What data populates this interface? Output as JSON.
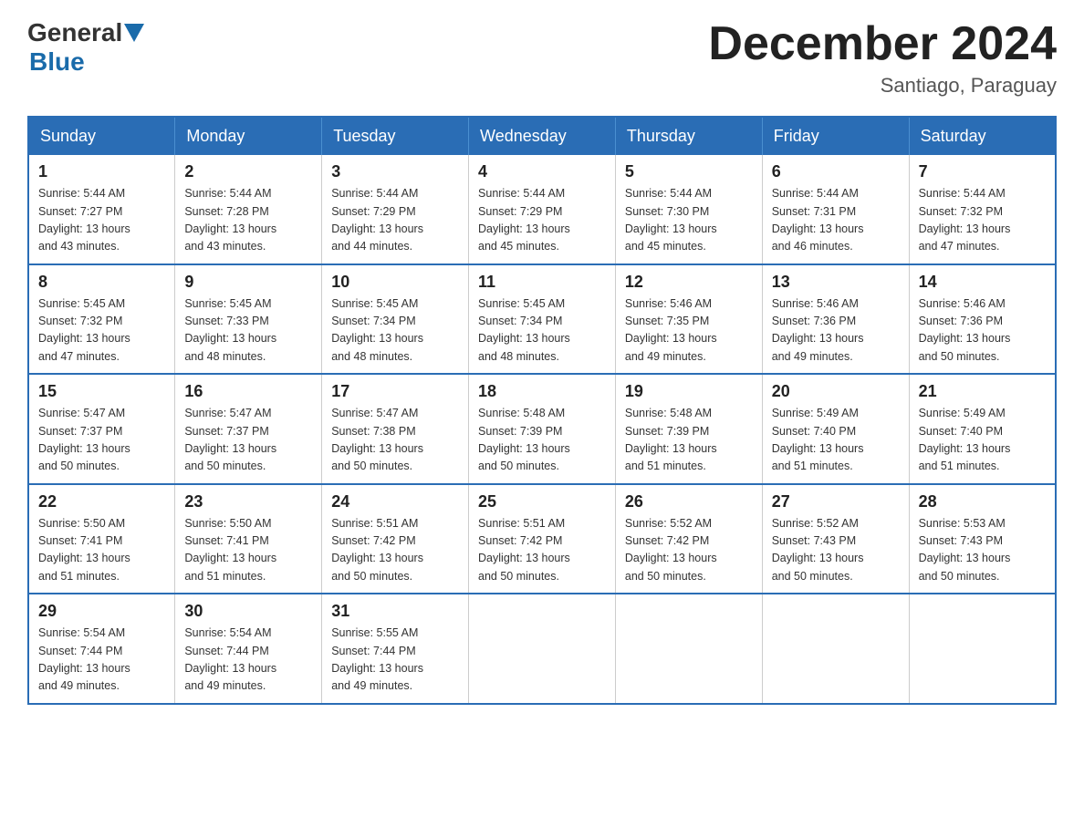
{
  "header": {
    "logo_general": "General",
    "logo_blue": "Blue",
    "month_title": "December 2024",
    "location": "Santiago, Paraguay"
  },
  "days_of_week": [
    "Sunday",
    "Monday",
    "Tuesday",
    "Wednesday",
    "Thursday",
    "Friday",
    "Saturday"
  ],
  "weeks": [
    [
      {
        "day": "1",
        "sunrise": "5:44 AM",
        "sunset": "7:27 PM",
        "daylight": "13 hours and 43 minutes."
      },
      {
        "day": "2",
        "sunrise": "5:44 AM",
        "sunset": "7:28 PM",
        "daylight": "13 hours and 43 minutes."
      },
      {
        "day": "3",
        "sunrise": "5:44 AM",
        "sunset": "7:29 PM",
        "daylight": "13 hours and 44 minutes."
      },
      {
        "day": "4",
        "sunrise": "5:44 AM",
        "sunset": "7:29 PM",
        "daylight": "13 hours and 45 minutes."
      },
      {
        "day": "5",
        "sunrise": "5:44 AM",
        "sunset": "7:30 PM",
        "daylight": "13 hours and 45 minutes."
      },
      {
        "day": "6",
        "sunrise": "5:44 AM",
        "sunset": "7:31 PM",
        "daylight": "13 hours and 46 minutes."
      },
      {
        "day": "7",
        "sunrise": "5:44 AM",
        "sunset": "7:32 PM",
        "daylight": "13 hours and 47 minutes."
      }
    ],
    [
      {
        "day": "8",
        "sunrise": "5:45 AM",
        "sunset": "7:32 PM",
        "daylight": "13 hours and 47 minutes."
      },
      {
        "day": "9",
        "sunrise": "5:45 AM",
        "sunset": "7:33 PM",
        "daylight": "13 hours and 48 minutes."
      },
      {
        "day": "10",
        "sunrise": "5:45 AM",
        "sunset": "7:34 PM",
        "daylight": "13 hours and 48 minutes."
      },
      {
        "day": "11",
        "sunrise": "5:45 AM",
        "sunset": "7:34 PM",
        "daylight": "13 hours and 48 minutes."
      },
      {
        "day": "12",
        "sunrise": "5:46 AM",
        "sunset": "7:35 PM",
        "daylight": "13 hours and 49 minutes."
      },
      {
        "day": "13",
        "sunrise": "5:46 AM",
        "sunset": "7:36 PM",
        "daylight": "13 hours and 49 minutes."
      },
      {
        "day": "14",
        "sunrise": "5:46 AM",
        "sunset": "7:36 PM",
        "daylight": "13 hours and 50 minutes."
      }
    ],
    [
      {
        "day": "15",
        "sunrise": "5:47 AM",
        "sunset": "7:37 PM",
        "daylight": "13 hours and 50 minutes."
      },
      {
        "day": "16",
        "sunrise": "5:47 AM",
        "sunset": "7:37 PM",
        "daylight": "13 hours and 50 minutes."
      },
      {
        "day": "17",
        "sunrise": "5:47 AM",
        "sunset": "7:38 PM",
        "daylight": "13 hours and 50 minutes."
      },
      {
        "day": "18",
        "sunrise": "5:48 AM",
        "sunset": "7:39 PM",
        "daylight": "13 hours and 50 minutes."
      },
      {
        "day": "19",
        "sunrise": "5:48 AM",
        "sunset": "7:39 PM",
        "daylight": "13 hours and 51 minutes."
      },
      {
        "day": "20",
        "sunrise": "5:49 AM",
        "sunset": "7:40 PM",
        "daylight": "13 hours and 51 minutes."
      },
      {
        "day": "21",
        "sunrise": "5:49 AM",
        "sunset": "7:40 PM",
        "daylight": "13 hours and 51 minutes."
      }
    ],
    [
      {
        "day": "22",
        "sunrise": "5:50 AM",
        "sunset": "7:41 PM",
        "daylight": "13 hours and 51 minutes."
      },
      {
        "day": "23",
        "sunrise": "5:50 AM",
        "sunset": "7:41 PM",
        "daylight": "13 hours and 51 minutes."
      },
      {
        "day": "24",
        "sunrise": "5:51 AM",
        "sunset": "7:42 PM",
        "daylight": "13 hours and 50 minutes."
      },
      {
        "day": "25",
        "sunrise": "5:51 AM",
        "sunset": "7:42 PM",
        "daylight": "13 hours and 50 minutes."
      },
      {
        "day": "26",
        "sunrise": "5:52 AM",
        "sunset": "7:42 PM",
        "daylight": "13 hours and 50 minutes."
      },
      {
        "day": "27",
        "sunrise": "5:52 AM",
        "sunset": "7:43 PM",
        "daylight": "13 hours and 50 minutes."
      },
      {
        "day": "28",
        "sunrise": "5:53 AM",
        "sunset": "7:43 PM",
        "daylight": "13 hours and 50 minutes."
      }
    ],
    [
      {
        "day": "29",
        "sunrise": "5:54 AM",
        "sunset": "7:44 PM",
        "daylight": "13 hours and 49 minutes."
      },
      {
        "day": "30",
        "sunrise": "5:54 AM",
        "sunset": "7:44 PM",
        "daylight": "13 hours and 49 minutes."
      },
      {
        "day": "31",
        "sunrise": "5:55 AM",
        "sunset": "7:44 PM",
        "daylight": "13 hours and 49 minutes."
      },
      null,
      null,
      null,
      null
    ]
  ],
  "labels": {
    "sunrise": "Sunrise:",
    "sunset": "Sunset:",
    "daylight": "Daylight:"
  }
}
